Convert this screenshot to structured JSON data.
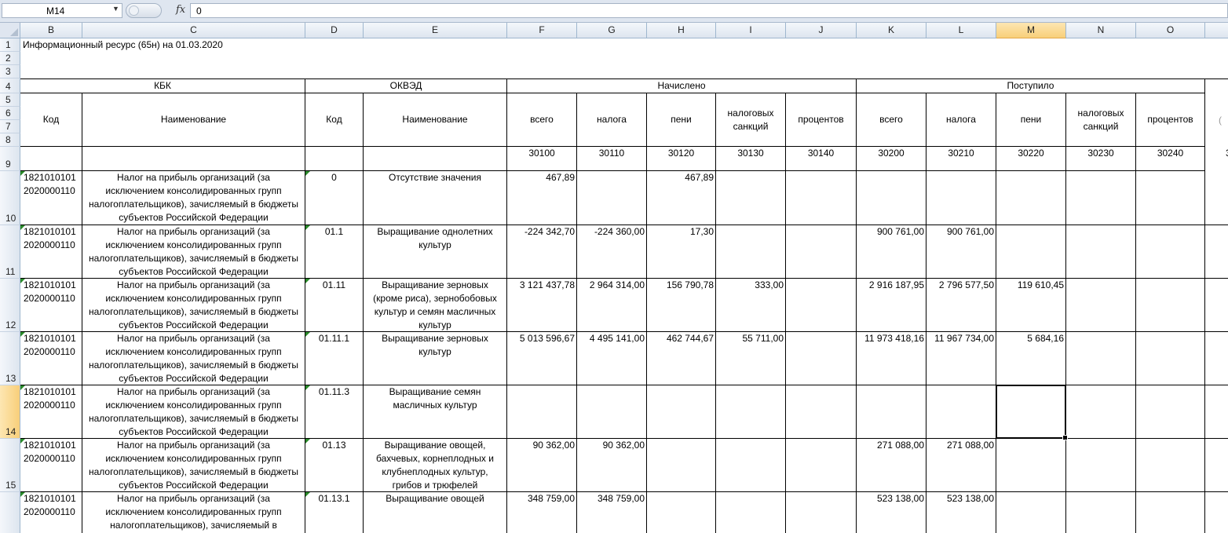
{
  "formula_bar": {
    "name_box": "M14",
    "fx_label": "fx",
    "formula_value": "0"
  },
  "columns": [
    "B",
    "C",
    "D",
    "E",
    "F",
    "G",
    "H",
    "I",
    "J",
    "K",
    "L",
    "M",
    "N",
    "O",
    ""
  ],
  "selected_column": "M",
  "selected_row": "14",
  "sheet": {
    "title": "Информационный ресурс (65н) на 01.03.2020",
    "groups": {
      "kbk": "КБК",
      "okved": "ОКВЭД",
      "nachisleno": "Начислено",
      "postupilo": "Поступило"
    },
    "subheaders": {
      "kod_b": "Код",
      "naim_c": "Наименование",
      "kod_d": "Код",
      "naim_e": "Наименование",
      "vsego_f": "всего",
      "naloga_g": "налога",
      "peni_h": "пени",
      "sankc_i": "налоговых санкций",
      "proc_j": "процентов",
      "vsego_k": "всего",
      "naloga_l": "налога",
      "peni_m": "пени",
      "sankc_n": "налоговых санкций",
      "proc_o": "процентов",
      "partial_p": "("
    },
    "codes": {
      "F": "30100",
      "G": "30110",
      "H": "30120",
      "I": "30130",
      "J": "30140",
      "K": "30200",
      "L": "30210",
      "M": "30220",
      "N": "30230",
      "O": "30240",
      "P": "3"
    },
    "rows": [
      {
        "num": "10",
        "b": "1821010101 2020000110",
        "c": "Налог на прибыль организаций (за исключением консолидированных групп налогоплательщиков), зачисляемый в бюджеты субъектов Российской Федерации",
        "d": "0",
        "e": "Отсутствие значения",
        "f": "467,89",
        "g": "",
        "h": "467,89",
        "i": "",
        "j": "",
        "k": "",
        "l": "",
        "m": "",
        "n": "",
        "o": ""
      },
      {
        "num": "11",
        "b": "1821010101 2020000110",
        "c": "Налог на прибыль организаций (за исключением консолидированных групп налогоплательщиков), зачисляемый в бюджеты субъектов Российской Федерации",
        "d": "01.1",
        "e": "Выращивание однолетних культур",
        "f": "-224 342,70",
        "g": "-224 360,00",
        "h": "17,30",
        "i": "",
        "j": "",
        "k": "900 761,00",
        "l": "900 761,00",
        "m": "",
        "n": "",
        "o": ""
      },
      {
        "num": "12",
        "b": "1821010101 2020000110",
        "c": "Налог на прибыль организаций (за исключением консолидированных групп налогоплательщиков), зачисляемый в бюджеты субъектов Российской Федерации",
        "d": "01.11",
        "e": "Выращивание зерновых (кроме риса), зернобобовых культур и семян масличных культур",
        "f": "3 121 437,78",
        "g": "2 964 314,00",
        "h": "156 790,78",
        "i": "333,00",
        "j": "",
        "k": "2 916 187,95",
        "l": "2 796 577,50",
        "m": "119 610,45",
        "n": "",
        "o": ""
      },
      {
        "num": "13",
        "b": "1821010101 2020000110",
        "c": "Налог на прибыль организаций (за исключением консолидированных групп налогоплательщиков), зачисляемый в бюджеты субъектов Российской Федерации",
        "d": "01.11.1",
        "e": "Выращивание зерновых культур",
        "f": "5 013 596,67",
        "g": "4 495 141,00",
        "h": "462 744,67",
        "i": "55 711,00",
        "j": "",
        "k": "11 973 418,16",
        "l": "11 967 734,00",
        "m": "5 684,16",
        "n": "",
        "o": ""
      },
      {
        "num": "14",
        "b": "1821010101 2020000110",
        "c": "Налог на прибыль организаций (за исключением консолидированных групп налогоплательщиков), зачисляемый в бюджеты субъектов Российской Федерации",
        "d": "01.11.3",
        "e": "Выращивание семян масличных культур",
        "f": "",
        "g": "",
        "h": "",
        "i": "",
        "j": "",
        "k": "",
        "l": "",
        "m": "",
        "n": "",
        "o": ""
      },
      {
        "num": "15",
        "b": "1821010101 2020000110",
        "c": "Налог на прибыль организаций (за исключением консолидированных групп налогоплательщиков), зачисляемый в бюджеты субъектов Российской Федерации",
        "d": "01.13",
        "e": "Выращивание овощей, бахчевых, корнеплодных и клубнеплодных культур, грибов и трюфелей",
        "f": "90 362,00",
        "g": "90 362,00",
        "h": "",
        "i": "",
        "j": "",
        "k": "271 088,00",
        "l": "271 088,00",
        "m": "",
        "n": "",
        "o": ""
      },
      {
        "num": "",
        "b": "1821010101 2020000110",
        "c": "Налог на прибыль организаций (за исключением консолидированных групп налогоплательщиков), зачисляемый в",
        "d": "01.13.1",
        "e": "Выращивание овощей",
        "f": "348 759,00",
        "g": "348 759,00",
        "h": "",
        "i": "",
        "j": "",
        "k": "523 138,00",
        "l": "523 138,00",
        "m": "",
        "n": "",
        "o": ""
      }
    ],
    "row_numbers": [
      "1",
      "2",
      "3",
      "4",
      "5",
      "6",
      "7",
      "8",
      "9"
    ]
  }
}
